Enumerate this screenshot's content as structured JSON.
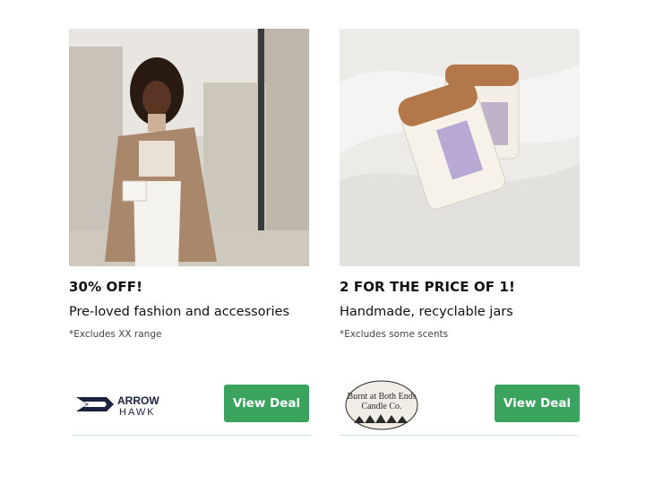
{
  "cards": [
    {
      "headline": "30% OFF!",
      "description": "Pre-loved fashion and accessories",
      "fineprint": "*Excludes XX range",
      "cta_label": "View Deal",
      "brand": {
        "name_top": "ARROW",
        "name_bottom": "HAWK",
        "icon": "arrowhawk-logo-icon"
      }
    },
    {
      "headline": "2 FOR THE PRICE OF 1!",
      "description": "Handmade, recyclable jars",
      "fineprint": "*Excludes some scents",
      "cta_label": "View Deal",
      "brand": {
        "name": "Burnt at Both Ends Candle Co.",
        "icon": "burnt-candle-logo-icon"
      }
    }
  ],
  "colors": {
    "button": "#3aa35e",
    "divider": "#cfe3dd"
  }
}
